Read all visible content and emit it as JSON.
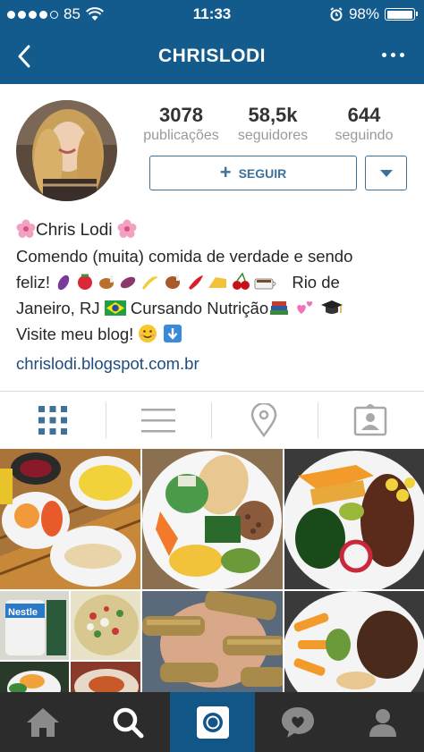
{
  "status_bar": {
    "carrier": "85",
    "time": "11:33",
    "battery": "98%",
    "battery_level": 0.98
  },
  "nav": {
    "title": "CHRISLODI",
    "back_icon": "chevron-left-icon",
    "more_icon": "more-horizontal-icon"
  },
  "profile": {
    "stats": [
      {
        "value": "3078",
        "label": "publicações"
      },
      {
        "value": "58,5k",
        "label": "seguidores"
      },
      {
        "value": "644",
        "label": "seguindo"
      }
    ],
    "follow_label": "SEGUIR",
    "name": "Chris Lodi",
    "bio_line1": "Comendo (muita) comida de verdade e sendo",
    "bio_line2_text": "feliz!",
    "bio_line2_end": "Rio de",
    "bio_line3": "Janeiro, RJ",
    "bio_line3_b": "Cursando Nutrição",
    "bio_line4": "Visite meu blog!",
    "website": "chrislodi.blogspot.com.br"
  },
  "tabs": [
    {
      "icon": "grid-icon",
      "active": true
    },
    {
      "icon": "list-icon",
      "active": false
    },
    {
      "icon": "location-pin-icon",
      "active": false
    },
    {
      "icon": "tagged-person-icon",
      "active": false
    }
  ],
  "bottom_nav": [
    {
      "icon": "home-icon",
      "active": false
    },
    {
      "icon": "search-icon",
      "active": false
    },
    {
      "icon": "camera-icon",
      "active": true
    },
    {
      "icon": "activity-heart-icon",
      "active": false
    },
    {
      "icon": "profile-icon",
      "active": false
    }
  ],
  "colors": {
    "header_bg": "#135b8d",
    "accent": "#3f729b",
    "link": "#1e4b7e",
    "bottom_bar": "#2c2c2c",
    "bottom_active": "#125688"
  }
}
